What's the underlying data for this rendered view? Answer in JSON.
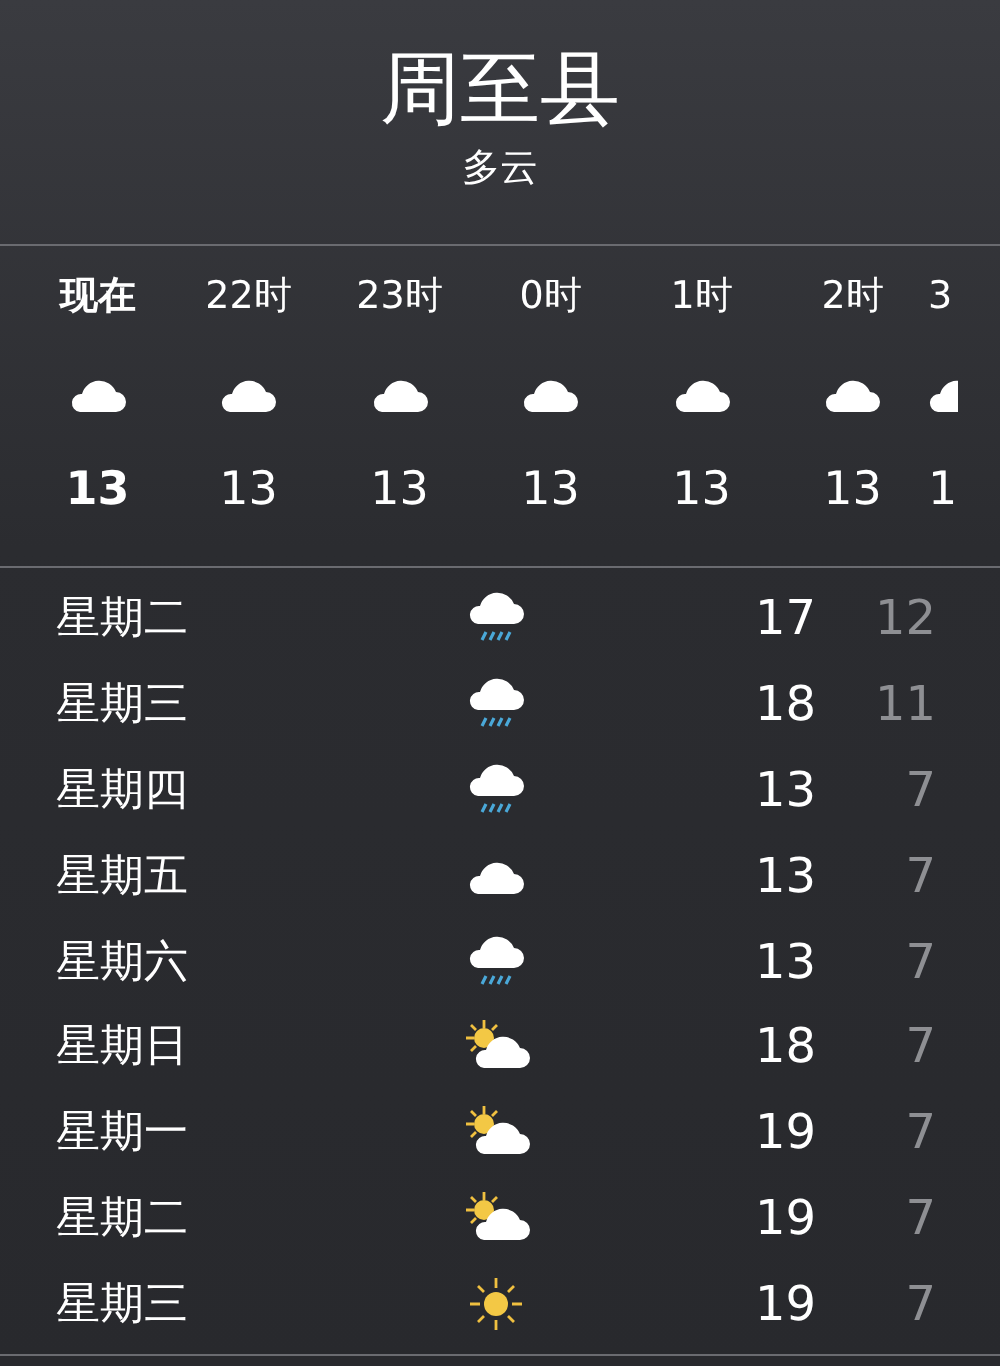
{
  "location": {
    "city": "周至县",
    "condition": "多云"
  },
  "hourly": [
    {
      "time": "现在",
      "kind": "cloud",
      "temp": "13",
      "current": true
    },
    {
      "time": "22时",
      "kind": "cloud",
      "temp": "13",
      "current": false
    },
    {
      "time": "23时",
      "kind": "cloud",
      "temp": "13",
      "current": false
    },
    {
      "time": "0时",
      "kind": "cloud",
      "temp": "13",
      "current": false
    },
    {
      "time": "1时",
      "kind": "cloud",
      "temp": "13",
      "current": false
    },
    {
      "time": "2时",
      "kind": "cloud",
      "temp": "13",
      "current": false
    },
    {
      "time": "3",
      "kind": "cloud",
      "temp": "1",
      "current": false
    }
  ],
  "daily": [
    {
      "day": "星期二",
      "kind": "rain",
      "high": "17",
      "low": "12"
    },
    {
      "day": "星期三",
      "kind": "rain",
      "high": "18",
      "low": "11"
    },
    {
      "day": "星期四",
      "kind": "rain",
      "high": "13",
      "low": "7"
    },
    {
      "day": "星期五",
      "kind": "cloud",
      "high": "13",
      "low": "7"
    },
    {
      "day": "星期六",
      "kind": "rain",
      "high": "13",
      "low": "7"
    },
    {
      "day": "星期日",
      "kind": "partly",
      "high": "18",
      "low": "7"
    },
    {
      "day": "星期一",
      "kind": "partly",
      "high": "19",
      "low": "7"
    },
    {
      "day": "星期二",
      "kind": "partly",
      "high": "19",
      "low": "7"
    },
    {
      "day": "星期三",
      "kind": "sun",
      "high": "19",
      "low": "7"
    }
  ]
}
